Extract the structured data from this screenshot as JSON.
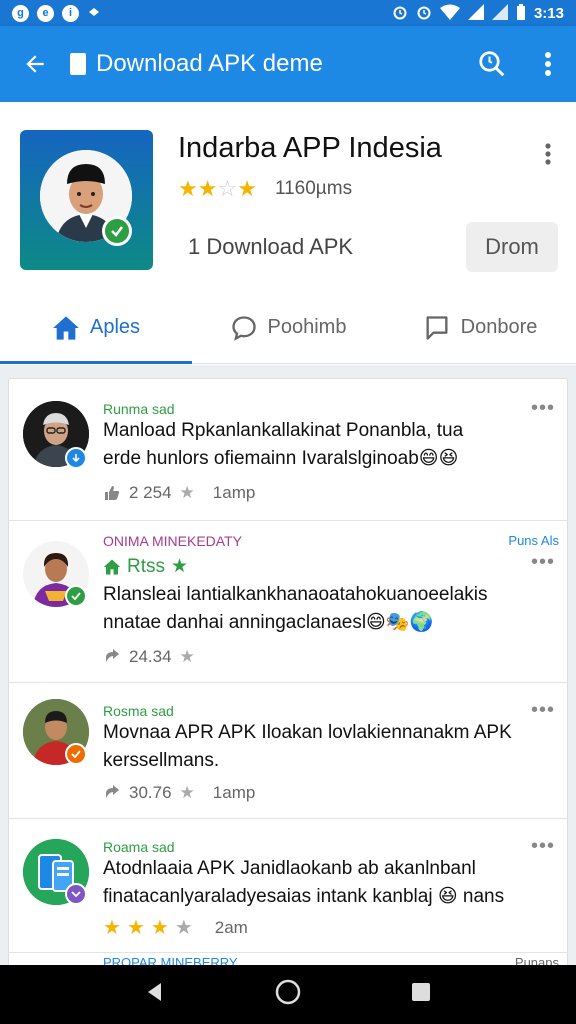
{
  "status": {
    "left_icons": [
      "g",
      "e",
      "i"
    ],
    "time": "3:13"
  },
  "appbar": {
    "title": "Download APK deme"
  },
  "app": {
    "name": "Indarba APP Indesia",
    "rating_count": "1160µms",
    "download_label": "1 Download APK",
    "button_label": "Drom"
  },
  "tabs": [
    {
      "label": "Aples",
      "icon": "home-icon"
    },
    {
      "label": "Poohimb",
      "icon": "comment-icon"
    },
    {
      "label": "Donbore",
      "icon": "chat-square-icon"
    }
  ],
  "posts": [
    {
      "name": "Runma sad",
      "tag": "",
      "text1": "Manload Rpkanlankallakinat Ponanbla, tua",
      "text2": "erde hunlors ofiemainn Ivaralslginoab😄😆",
      "count": "2 254",
      "time": "1amp"
    },
    {
      "name": "ONIMA MINEKEDATY",
      "tag": "Puns Als",
      "rtss": "Rtss",
      "text1": "Rlansleai lantialkankhanaoatahokuanoeelakis",
      "text2": "nnatae danhai anningaclanaesl😄🎭🌍",
      "count": "24.34",
      "time": ""
    },
    {
      "name": "Rosma sad",
      "tag": "",
      "text1": "Movnaa APR APK Iloakan lovlakiennanakm APK",
      "text2": "kerssellmans.",
      "count": "30.76",
      "time": "1amp"
    },
    {
      "name": "Roama sad",
      "tag": "",
      "text1": "Atodnlaaia APK Janidlaokanb ab akanlnbanl",
      "text2": "finatacanlyaraladyesaias intank kanblaj 😆 nans",
      "rating": 3,
      "time": "2am"
    },
    {
      "name": "PROPAR MINEBERRY",
      "tag": "Punaps"
    }
  ]
}
